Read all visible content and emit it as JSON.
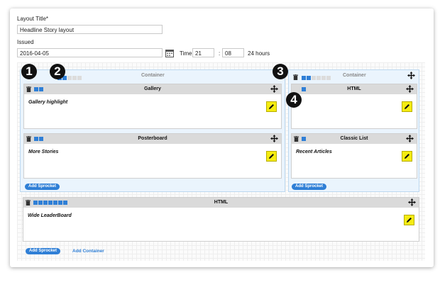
{
  "form": {
    "layout_title_label": "Layout Title*",
    "layout_title_value": "Headline Story layout",
    "issued_label": "Issued",
    "date_value": "2016-04-05",
    "time_label": "Time",
    "hour_value": "21",
    "colon": ":",
    "minute_value": "08",
    "time_format": "24 hours"
  },
  "containers": [
    {
      "title": "Container",
      "columns_on": 2,
      "columns_total": 5,
      "sprockets": [
        {
          "title": "Gallery",
          "columns_on": 2,
          "body": "Gallery highlight"
        },
        {
          "title": "Posterboard",
          "columns_on": 2,
          "body": "More Stories"
        }
      ],
      "add_sprocket": "Add Sprocket"
    },
    {
      "title": "Container",
      "columns_on": 2,
      "columns_total": 6,
      "sprockets": [
        {
          "title": "HTML",
          "columns_on": 1,
          "body": ""
        },
        {
          "title": "Classic List",
          "columns_on": 1,
          "body": "Recent Articles"
        }
      ],
      "add_sprocket": "Add Sprocket"
    }
  ],
  "wide_sprocket": {
    "title": "HTML",
    "columns_on": 7,
    "body": "Wide LeaderBoard"
  },
  "footer": {
    "add_sprocket": "Add Sprocket",
    "add_container": "Add Container"
  },
  "badges": [
    "1",
    "2",
    "3",
    "4"
  ],
  "colors": {
    "accent": "#2f7fd6",
    "edit": "#f5ec11",
    "container_bg": "#eaf4fd",
    "header_gray": "#dadada"
  },
  "icons": {
    "trash": "trash-icon",
    "move": "move-icon",
    "edit": "pencil-icon",
    "calendar": "calendar-icon"
  }
}
